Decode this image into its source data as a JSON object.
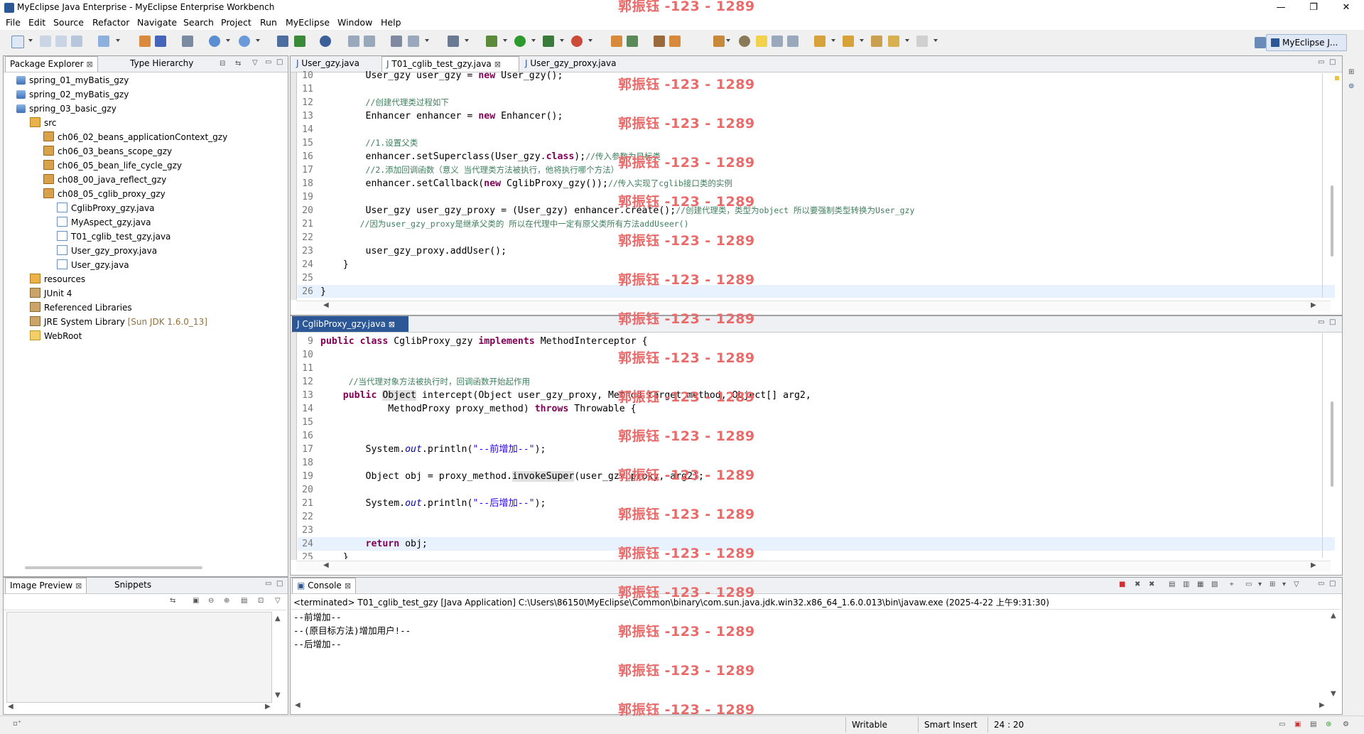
{
  "window": {
    "title": "MyEclipse Java Enterprise - MyEclipse Enterprise Workbench",
    "min": "—",
    "max": "❐",
    "close": "✕"
  },
  "menu": [
    "File",
    "Edit",
    "Source",
    "Refactor",
    "Navigate",
    "Search",
    "Project",
    "Run",
    "MyEclipse",
    "Window",
    "Help"
  ],
  "perspective": {
    "label": "MyEclipse J..."
  },
  "watermark": "郭振钰 -123 - 1289",
  "explorer": {
    "tab_active": "Package Explorer",
    "tab_other": "Type Hierarchy",
    "tree": [
      {
        "label": "spring_01_myBatis_gzy",
        "icon": "project-icon",
        "depth": 1
      },
      {
        "label": "spring_02_myBatis_gzy",
        "icon": "project-icon",
        "depth": 1
      },
      {
        "label": "spring_03_basic_gzy",
        "icon": "project-icon",
        "depth": 1
      },
      {
        "label": "src",
        "icon": "source-folder-icon",
        "depth": 2
      },
      {
        "label": "ch06_02_beans_applicationContext_gzy",
        "icon": "package-icon",
        "depth": 3
      },
      {
        "label": "ch06_03_beans_scope_gzy",
        "icon": "package-icon",
        "depth": 3
      },
      {
        "label": "ch06_05_bean_life_cycle_gzy",
        "icon": "package-icon",
        "depth": 3
      },
      {
        "label": "ch08_00_java_reflect_gzy",
        "icon": "package-icon",
        "depth": 3
      },
      {
        "label": "ch08_05_cglib_proxy_gzy",
        "icon": "package-icon",
        "depth": 3
      },
      {
        "label": "CglibProxy_gzy.java",
        "icon": "java-file-icon",
        "depth": 4
      },
      {
        "label": "MyAspect_gzy.java",
        "icon": "java-file-icon",
        "depth": 4
      },
      {
        "label": "T01_cglib_test_gzy.java",
        "icon": "java-file-icon",
        "depth": 4
      },
      {
        "label": "User_gzy_proxy.java",
        "icon": "java-file-icon",
        "depth": 4
      },
      {
        "label": "User_gzy.java",
        "icon": "java-file-icon",
        "depth": 4
      },
      {
        "label": "resources",
        "icon": "source-folder-icon",
        "depth": 2
      },
      {
        "label": "JUnit 4",
        "icon": "library-icon",
        "depth": 2
      },
      {
        "label": "Referenced Libraries",
        "icon": "library-icon",
        "depth": 2
      },
      {
        "label": "JRE System Library",
        "decor": "[Sun JDK 1.6.0_13]",
        "icon": "library-icon",
        "depth": 2
      },
      {
        "label": "WebRoot",
        "icon": "folder-icon",
        "depth": 2
      }
    ]
  },
  "image_preview": {
    "tab_active": "Image Preview",
    "tab_other": "Snippets"
  },
  "editor_top": {
    "tabs": [
      "User_gzy.java",
      "T01_cglib_test_gzy.java",
      "User_gzy_proxy.java"
    ],
    "active_tab": 1,
    "lines": [
      {
        "n": "10",
        "html": "        User_gzy user_gzy = <span class='kw'>new</span> User_gzy();"
      },
      {
        "n": "11",
        "html": ""
      },
      {
        "n": "12",
        "html": "        <span class='cm'>//创建代理类过程如下</span>"
      },
      {
        "n": "13",
        "html": "        Enhancer enhancer = <span class='kw'>new</span> Enhancer();"
      },
      {
        "n": "14",
        "html": ""
      },
      {
        "n": "15",
        "html": "        <span class='cm'>//1.设置父类</span>"
      },
      {
        "n": "16",
        "html": "        enhancer.setSuperclass(User_gzy.<span class='kw'>class</span>);<span class='cm'>//传入参数为目标类</span>"
      },
      {
        "n": "17",
        "html": "        <span class='cm'>//2.添加回调函数（意义 当代理类方法被执行，他将执行哪个方法）</span>"
      },
      {
        "n": "18",
        "html": "        enhancer.setCallback(<span class='kw'>new</span> CglibProxy_gzy());<span class='cm'>//传入实现了cglib接口类的实例</span>"
      },
      {
        "n": "19",
        "html": ""
      },
      {
        "n": "20",
        "html": "        User_gzy user_gzy_proxy = (User_gzy) enhancer.create();<span class='cm'>//创建代理类，类型为object 所以要强制类型转换为User_gzy</span>"
      },
      {
        "n": "21",
        "html": "       <span class='cm'>//因为user_gzy_proxy是继承父类的 所以在代理中一定有原父类所有方法addUseer()</span>"
      },
      {
        "n": "22",
        "html": ""
      },
      {
        "n": "23",
        "html": "        user_gzy_proxy.addUser();"
      },
      {
        "n": "24",
        "html": "    }"
      },
      {
        "n": "25",
        "html": ""
      },
      {
        "n": "26",
        "html": "}"
      }
    ]
  },
  "editor_bottom": {
    "tab": "CglibProxy_gzy.java",
    "lines": [
      {
        "n": "9",
        "html": "<span class='kw'>public</span> <span class='kw'>class</span> CglibProxy_gzy <span class='kw'>implements</span> MethodInterceptor {"
      },
      {
        "n": "10",
        "html": ""
      },
      {
        "n": "11",
        "html": ""
      },
      {
        "n": "12",
        "html": "     <span class='cm'>//当代理对象方法被执行时，回调函数开始起作用</span>"
      },
      {
        "n": "13",
        "html": "    <span class='kw'>public</span> <span style='background:#e0e0e0'>Object</span> intercept(Object user_gzy_proxy, Method target_method, Object[] arg2,"
      },
      {
        "n": "14",
        "html": "            MethodProxy proxy_method) <span class='kw'>throws</span> Throwable {"
      },
      {
        "n": "15",
        "html": ""
      },
      {
        "n": "16",
        "html": ""
      },
      {
        "n": "17",
        "html": "        System.<span class='it'>out</span>.println(<span class='str'>\"--前增加--\"</span>);"
      },
      {
        "n": "18",
        "html": ""
      },
      {
        "n": "19",
        "html": "        Object obj = proxy_method.<span style='background:#e0e0e0'>invokeSuper</span>(user_gzy_proxy, arg2);"
      },
      {
        "n": "20",
        "html": ""
      },
      {
        "n": "21",
        "html": "        System.<span class='it'>out</span>.println(<span class='str'>\"--后增加--\"</span>);"
      },
      {
        "n": "22",
        "html": ""
      },
      {
        "n": "23",
        "html": ""
      },
      {
        "n": "24",
        "html": "        <span class='kw'>return</span> obj;"
      },
      {
        "n": "25",
        "html": "    }"
      }
    ]
  },
  "console": {
    "tab": "Console",
    "header": "<terminated> T01_cglib_test_gzy [Java Application] C:\\Users\\86150\\MyEclipse\\Common\\binary\\com.sun.java.jdk.win32.x86_64_1.6.0.013\\bin\\javaw.exe (2025-4-22 上午9:31:30)",
    "output": [
      "--前增加--",
      "--(原目标方法)增加用户!--",
      "--后增加--"
    ]
  },
  "status": {
    "mode": "Writable",
    "insert": "Smart Insert",
    "position": "24 : 20"
  },
  "colors": {
    "watermark": "#ea6a6a",
    "keyword": "#7f0055",
    "comment": "#3f7f5f",
    "string": "#2a00ff"
  }
}
